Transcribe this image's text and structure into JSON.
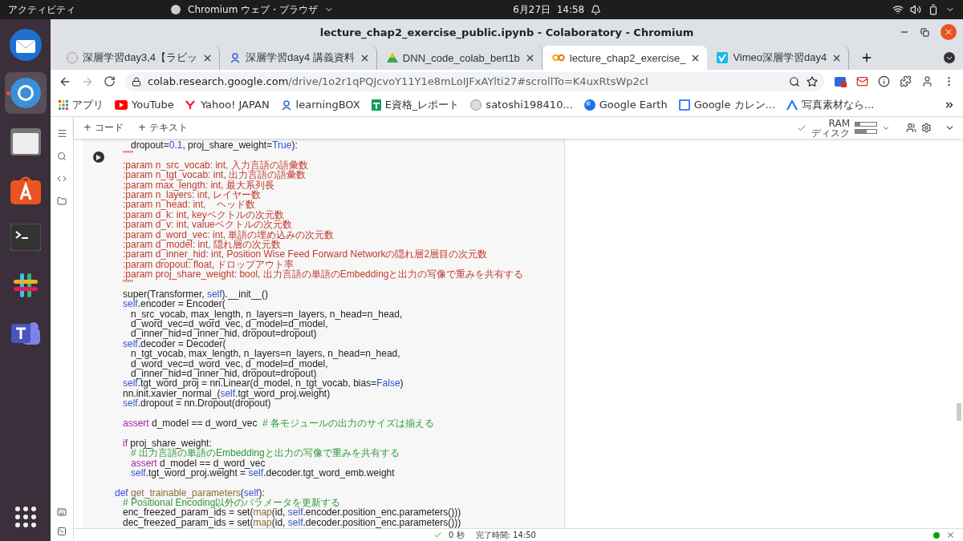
{
  "topbar": {
    "activities": "アクティビティ",
    "app": "Chromium ウェブ・ブラウザ",
    "clock": "6月27日  14:58"
  },
  "dock": [
    {
      "kind": "mail",
      "selected": false
    },
    {
      "kind": "browser",
      "selected": true
    },
    {
      "kind": "files",
      "selected": false
    },
    {
      "kind": "store",
      "selected": false
    },
    {
      "kind": "terminal",
      "selected": false
    },
    {
      "kind": "chat",
      "selected": false
    },
    {
      "kind": "teams",
      "selected": false
    }
  ],
  "window": {
    "title": "lecture_chap2_exercise_public.ipynb - Colaboratory - Chromium"
  },
  "tabs": [
    {
      "label": "深層学習day3,4【ラビッ",
      "selected": false
    },
    {
      "label": "深層学習day4 講義資料",
      "selected": false
    },
    {
      "label": "DNN_code_colab_bert1b",
      "selected": false
    },
    {
      "label": "lecture_chap2_exercise_",
      "selected": true
    },
    {
      "label": "Vimeo深層学習day4",
      "selected": false
    }
  ],
  "address": {
    "host": "colab.research.google.com",
    "path": "/drive/1o2r1qPQJcvoY11Y1e8mLoIJFxAYlti27#scrollTo=K4uxRtsWp2cI"
  },
  "bookmarks": [
    {
      "label": "アプリ"
    },
    {
      "label": "YouTube"
    },
    {
      "label": "Yahoo! JAPAN"
    },
    {
      "label": "learningBOX"
    },
    {
      "label": "E資格_レポート"
    },
    {
      "label": "satoshi198410..."
    },
    {
      "label": "Google Earth"
    },
    {
      "label": "Google カレン..."
    },
    {
      "label": "写真素材なら..."
    }
  ],
  "toolbar": {
    "add_code": "+ コード",
    "add_text": "+ テキスト",
    "ram": "RAM",
    "disk": "ディスク"
  },
  "code_lines": [
    {
      "kind": "code",
      "tokens": [
        {
          "kind": "t",
          "text": "      dropout="
        },
        {
          "kind": "n",
          "text": "0.1"
        },
        {
          "kind": "t",
          "text": ", proj_share_weight="
        },
        {
          "kind": "n",
          "text": "True"
        },
        {
          "kind": "t",
          "text": "):"
        }
      ]
    },
    {
      "kind": "code",
      "tokens": [
        {
          "kind": "s",
          "text": "   \"\"\""
        }
      ]
    },
    {
      "kind": "code",
      "tokens": [
        {
          "kind": "s",
          "text": "   :param n_src_vocab: int, 入力言語の語彙数"
        }
      ]
    },
    {
      "kind": "code",
      "tokens": [
        {
          "kind": "s",
          "text": "   :param n_tgt_vocab: int, 出力言語の語彙数"
        }
      ]
    },
    {
      "kind": "code",
      "tokens": [
        {
          "kind": "s",
          "text": "   :param max_length: int, 最大系列長"
        }
      ]
    },
    {
      "kind": "code",
      "tokens": [
        {
          "kind": "s",
          "text": "   :param n_layers: int, レイヤー数"
        }
      ]
    },
    {
      "kind": "code",
      "tokens": [
        {
          "kind": "s",
          "text": "   :param n_head: int,    ヘッド数"
        }
      ]
    },
    {
      "kind": "code",
      "tokens": [
        {
          "kind": "s",
          "text": "   :param d_k: int, keyベクトルの次元数"
        }
      ]
    },
    {
      "kind": "code",
      "tokens": [
        {
          "kind": "s",
          "text": "   :param d_v: int, valueベクトルの次元数"
        }
      ]
    },
    {
      "kind": "code",
      "tokens": [
        {
          "kind": "s",
          "text": "   :param d_word_vec: int, 単語の埋め込みの次元数"
        }
      ]
    },
    {
      "kind": "code",
      "tokens": [
        {
          "kind": "s",
          "text": "   :param d_model: int, 隠れ層の次元数"
        }
      ]
    },
    {
      "kind": "code",
      "tokens": [
        {
          "kind": "s",
          "text": "   :param d_inner_hid: int, Position Wise Feed Forward Networkの隠れ層2層目の次元数"
        }
      ]
    },
    {
      "kind": "code",
      "tokens": [
        {
          "kind": "s",
          "text": "   :param dropout: float, ドロップアウト率"
        }
      ]
    },
    {
      "kind": "code",
      "tokens": [
        {
          "kind": "s",
          "text": "   :param proj_share_weight: bool, 出力言語の単語のEmbeddingと出力の写像で重みを共有する"
        }
      ]
    },
    {
      "kind": "code",
      "tokens": [
        {
          "kind": "s",
          "text": "   \"\"\""
        }
      ]
    },
    {
      "kind": "code",
      "tokens": [
        {
          "kind": "t",
          "text": "   super(Transformer, "
        },
        {
          "kind": "self",
          "text": "self"
        },
        {
          "kind": "t",
          "text": ").__init__()"
        }
      ]
    },
    {
      "kind": "code",
      "tokens": [
        {
          "kind": "self",
          "text": "   self"
        },
        {
          "kind": "t",
          "text": ".encoder = Encoder("
        }
      ]
    },
    {
      "kind": "code",
      "tokens": [
        {
          "kind": "t",
          "text": "      n_src_vocab, max_length, n_layers=n_layers, n_head=n_head,"
        }
      ]
    },
    {
      "kind": "code",
      "tokens": [
        {
          "kind": "t",
          "text": "      d_word_vec=d_word_vec, d_model=d_model,"
        }
      ]
    },
    {
      "kind": "code",
      "tokens": [
        {
          "kind": "t",
          "text": "      d_inner_hid=d_inner_hid, dropout=dropout)"
        }
      ]
    },
    {
      "kind": "code",
      "tokens": [
        {
          "kind": "self",
          "text": "   self"
        },
        {
          "kind": "t",
          "text": ".decoder = Decoder("
        }
      ]
    },
    {
      "kind": "code",
      "tokens": [
        {
          "kind": "t",
          "text": "      n_tgt_vocab, max_length, n_layers=n_layers, n_head=n_head,"
        }
      ]
    },
    {
      "kind": "code",
      "tokens": [
        {
          "kind": "t",
          "text": "      d_word_vec=d_word_vec, d_model=d_model,"
        }
      ]
    },
    {
      "kind": "code",
      "tokens": [
        {
          "kind": "t",
          "text": "      d_inner_hid=d_inner_hid, dropout=dropout)"
        }
      ]
    },
    {
      "kind": "code",
      "tokens": [
        {
          "kind": "self",
          "text": "   self"
        },
        {
          "kind": "t",
          "text": ".tgt_word_proj = nn.Linear(d_model, n_tgt_vocab, bias="
        },
        {
          "kind": "n",
          "text": "False"
        },
        {
          "kind": "t",
          "text": ")"
        }
      ]
    },
    {
      "kind": "code",
      "tokens": [
        {
          "kind": "t",
          "text": "   nn.init.xavier_normal_("
        },
        {
          "kind": "self",
          "text": "self"
        },
        {
          "kind": "t",
          "text": ".tgt_word_proj.weight)"
        }
      ]
    },
    {
      "kind": "code",
      "tokens": [
        {
          "kind": "self",
          "text": "   self"
        },
        {
          "kind": "t",
          "text": ".dropout = nn.Dropout(dropout)"
        }
      ]
    },
    {
      "kind": "blank"
    },
    {
      "kind": "code",
      "tokens": [
        {
          "kind": "k",
          "text": "   assert"
        },
        {
          "kind": "t",
          "text": " d_model == d_word_vec  "
        },
        {
          "kind": "c",
          "text": "# 各モジュールの出力のサイズは揃える"
        }
      ]
    },
    {
      "kind": "blank"
    },
    {
      "kind": "code",
      "tokens": [
        {
          "kind": "k",
          "text": "   if"
        },
        {
          "kind": "t",
          "text": " proj_share_weight:"
        }
      ]
    },
    {
      "kind": "code",
      "tokens": [
        {
          "kind": "c",
          "text": "      # 出力言語の単語のEmbeddingと出力の写像で重みを共有する"
        }
      ]
    },
    {
      "kind": "code",
      "tokens": [
        {
          "kind": "k",
          "text": "      assert"
        },
        {
          "kind": "t",
          "text": " d_model == d_word_vec"
        }
      ]
    },
    {
      "kind": "code",
      "tokens": [
        {
          "kind": "self",
          "text": "      self"
        },
        {
          "kind": "t",
          "text": ".tgt_word_proj.weight = "
        },
        {
          "kind": "self",
          "text": "self"
        },
        {
          "kind": "t",
          "text": ".decoder.tgt_word_emb.weight"
        }
      ]
    },
    {
      "kind": "blank"
    },
    {
      "kind": "code",
      "tokens": [
        {
          "kind": "n",
          "text": "def"
        },
        {
          "kind": "f",
          "text": " get_trainable_parameters"
        },
        {
          "kind": "t",
          "text": "("
        },
        {
          "kind": "self",
          "text": "self"
        },
        {
          "kind": "t",
          "text": "):"
        }
      ]
    },
    {
      "kind": "code",
      "tokens": [
        {
          "kind": "c",
          "text": "   # Positional Encoding以外のパラメータを更新する"
        }
      ]
    },
    {
      "kind": "code",
      "tokens": [
        {
          "kind": "t",
          "text": "   enc_freezed_param_ids = set("
        },
        {
          "kind": "f",
          "text": "map"
        },
        {
          "kind": "t",
          "text": "(id, "
        },
        {
          "kind": "self",
          "text": "self"
        },
        {
          "kind": "t",
          "text": ".encoder.position_enc.parameters()))"
        }
      ]
    },
    {
      "kind": "code",
      "tokens": [
        {
          "kind": "t",
          "text": "   dec_freezed_param_ids = set("
        },
        {
          "kind": "f",
          "text": "map"
        },
        {
          "kind": "t",
          "text": "(id, "
        },
        {
          "kind": "self",
          "text": "self"
        },
        {
          "kind": "t",
          "text": ".decoder.position_enc.parameters()))"
        }
      ]
    }
  ],
  "status": {
    "duration": "0 秒",
    "finished": "完了時間: 14:50"
  }
}
